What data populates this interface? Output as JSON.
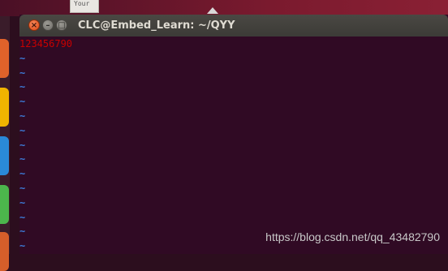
{
  "desktop": {
    "note_label": "Your",
    "launcher_colors": [
      "#e0622a",
      "#f0b400",
      "#2a8ad8",
      "#4cb64c",
      "#d65e2a"
    ]
  },
  "window": {
    "title": "CLC@Embed_Learn: ~/QYY",
    "close_glyph": "×",
    "minimize_glyph": "–",
    "maximize_glyph": "□"
  },
  "editor": {
    "first_line": "123456790",
    "empty_line_marker": "~",
    "empty_line_count": 14,
    "text_color": "#c80000",
    "tilde_color": "#3d7ad6",
    "background": "#300a24"
  },
  "watermark": "https://blog.csdn.net/qq_43482790"
}
